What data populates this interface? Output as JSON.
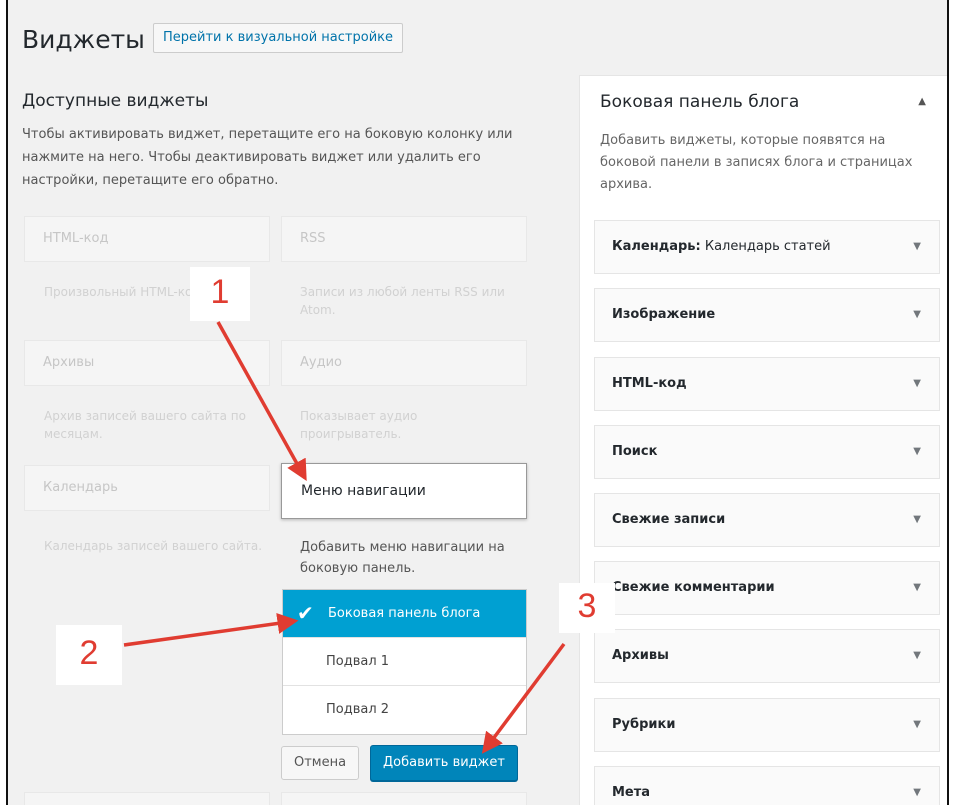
{
  "header": {
    "title": "Виджеты",
    "visual_settings_button": "Перейти к визуальной настройке"
  },
  "available": {
    "title": "Доступные виджеты",
    "description": "Чтобы активировать виджет, перетащите его на боковую колонку или нажмите на него. Чтобы деактивировать виджет или удалить его настройки, перетащите его обратно.",
    "widgets": [
      {
        "name": "HTML-код",
        "desc": "Произвольный HTML-код."
      },
      {
        "name": "RSS",
        "desc": "Записи из любой ленты RSS или Atom."
      },
      {
        "name": "Архивы",
        "desc": "Архив записей вашего сайта по месяцам."
      },
      {
        "name": "Аудио",
        "desc": "Показывает аудио проигрыватель."
      },
      {
        "name": "Календарь",
        "desc": "Календарь записей вашего сайта."
      }
    ]
  },
  "nav_menu_widget": {
    "name": "Меню навигации",
    "description": "Добавить меню навигации на боковую панель.",
    "areas": [
      {
        "label": "Боковая панель блога",
        "selected": true
      },
      {
        "label": "Подвал 1",
        "selected": false
      },
      {
        "label": "Подвал 2",
        "selected": false
      }
    ],
    "cancel_label": "Отмена",
    "add_label": "Добавить виджет"
  },
  "sidebar": {
    "title": "Боковая панель блога",
    "description": "Добавить виджеты, которые появятся на боковой панели в записях блога и страницах архива.",
    "widgets": [
      {
        "name": "Календарь:",
        "subtitle": "Календарь статей"
      },
      {
        "name": "Изображение",
        "subtitle": ""
      },
      {
        "name": "HTML-код",
        "subtitle": ""
      },
      {
        "name": "Поиск",
        "subtitle": ""
      },
      {
        "name": "Свежие записи",
        "subtitle": ""
      },
      {
        "name": "Свежие комментарии",
        "subtitle": ""
      },
      {
        "name": "Архивы",
        "subtitle": ""
      },
      {
        "name": "Рубрики",
        "subtitle": ""
      },
      {
        "name": "Мета",
        "subtitle": ""
      }
    ]
  },
  "annotations": {
    "step1": "1",
    "step2": "2",
    "step3": "3",
    "color": "#e03c31"
  },
  "icons": {
    "check": "✔",
    "collapse": "▲",
    "expand": "▼"
  },
  "colors": {
    "accent": "#00a0d2",
    "primary_button": "#0085ba",
    "link": "#0073aa"
  }
}
